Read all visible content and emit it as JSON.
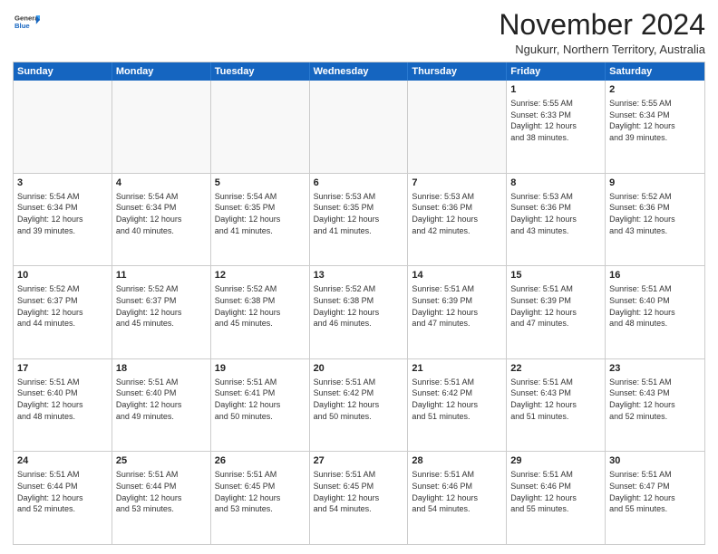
{
  "logo": {
    "line1": "General",
    "line2": "Blue"
  },
  "title": "November 2024",
  "subtitle": "Ngukurr, Northern Territory, Australia",
  "header_days": [
    "Sunday",
    "Monday",
    "Tuesday",
    "Wednesday",
    "Thursday",
    "Friday",
    "Saturday"
  ],
  "rows": [
    [
      {
        "day": "",
        "empty": true
      },
      {
        "day": "",
        "empty": true
      },
      {
        "day": "",
        "empty": true
      },
      {
        "day": "",
        "empty": true
      },
      {
        "day": "",
        "empty": true
      },
      {
        "day": "1",
        "info": "Sunrise: 5:55 AM\nSunset: 6:33 PM\nDaylight: 12 hours\nand 38 minutes."
      },
      {
        "day": "2",
        "info": "Sunrise: 5:55 AM\nSunset: 6:34 PM\nDaylight: 12 hours\nand 39 minutes."
      }
    ],
    [
      {
        "day": "3",
        "info": "Sunrise: 5:54 AM\nSunset: 6:34 PM\nDaylight: 12 hours\nand 39 minutes."
      },
      {
        "day": "4",
        "info": "Sunrise: 5:54 AM\nSunset: 6:34 PM\nDaylight: 12 hours\nand 40 minutes."
      },
      {
        "day": "5",
        "info": "Sunrise: 5:54 AM\nSunset: 6:35 PM\nDaylight: 12 hours\nand 41 minutes."
      },
      {
        "day": "6",
        "info": "Sunrise: 5:53 AM\nSunset: 6:35 PM\nDaylight: 12 hours\nand 41 minutes."
      },
      {
        "day": "7",
        "info": "Sunrise: 5:53 AM\nSunset: 6:36 PM\nDaylight: 12 hours\nand 42 minutes."
      },
      {
        "day": "8",
        "info": "Sunrise: 5:53 AM\nSunset: 6:36 PM\nDaylight: 12 hours\nand 43 minutes."
      },
      {
        "day": "9",
        "info": "Sunrise: 5:52 AM\nSunset: 6:36 PM\nDaylight: 12 hours\nand 43 minutes."
      }
    ],
    [
      {
        "day": "10",
        "info": "Sunrise: 5:52 AM\nSunset: 6:37 PM\nDaylight: 12 hours\nand 44 minutes."
      },
      {
        "day": "11",
        "info": "Sunrise: 5:52 AM\nSunset: 6:37 PM\nDaylight: 12 hours\nand 45 minutes."
      },
      {
        "day": "12",
        "info": "Sunrise: 5:52 AM\nSunset: 6:38 PM\nDaylight: 12 hours\nand 45 minutes."
      },
      {
        "day": "13",
        "info": "Sunrise: 5:52 AM\nSunset: 6:38 PM\nDaylight: 12 hours\nand 46 minutes."
      },
      {
        "day": "14",
        "info": "Sunrise: 5:51 AM\nSunset: 6:39 PM\nDaylight: 12 hours\nand 47 minutes."
      },
      {
        "day": "15",
        "info": "Sunrise: 5:51 AM\nSunset: 6:39 PM\nDaylight: 12 hours\nand 47 minutes."
      },
      {
        "day": "16",
        "info": "Sunrise: 5:51 AM\nSunset: 6:40 PM\nDaylight: 12 hours\nand 48 minutes."
      }
    ],
    [
      {
        "day": "17",
        "info": "Sunrise: 5:51 AM\nSunset: 6:40 PM\nDaylight: 12 hours\nand 48 minutes."
      },
      {
        "day": "18",
        "info": "Sunrise: 5:51 AM\nSunset: 6:40 PM\nDaylight: 12 hours\nand 49 minutes."
      },
      {
        "day": "19",
        "info": "Sunrise: 5:51 AM\nSunset: 6:41 PM\nDaylight: 12 hours\nand 50 minutes."
      },
      {
        "day": "20",
        "info": "Sunrise: 5:51 AM\nSunset: 6:42 PM\nDaylight: 12 hours\nand 50 minutes."
      },
      {
        "day": "21",
        "info": "Sunrise: 5:51 AM\nSunset: 6:42 PM\nDaylight: 12 hours\nand 51 minutes."
      },
      {
        "day": "22",
        "info": "Sunrise: 5:51 AM\nSunset: 6:43 PM\nDaylight: 12 hours\nand 51 minutes."
      },
      {
        "day": "23",
        "info": "Sunrise: 5:51 AM\nSunset: 6:43 PM\nDaylight: 12 hours\nand 52 minutes."
      }
    ],
    [
      {
        "day": "24",
        "info": "Sunrise: 5:51 AM\nSunset: 6:44 PM\nDaylight: 12 hours\nand 52 minutes."
      },
      {
        "day": "25",
        "info": "Sunrise: 5:51 AM\nSunset: 6:44 PM\nDaylight: 12 hours\nand 53 minutes."
      },
      {
        "day": "26",
        "info": "Sunrise: 5:51 AM\nSunset: 6:45 PM\nDaylight: 12 hours\nand 53 minutes."
      },
      {
        "day": "27",
        "info": "Sunrise: 5:51 AM\nSunset: 6:45 PM\nDaylight: 12 hours\nand 54 minutes."
      },
      {
        "day": "28",
        "info": "Sunrise: 5:51 AM\nSunset: 6:46 PM\nDaylight: 12 hours\nand 54 minutes."
      },
      {
        "day": "29",
        "info": "Sunrise: 5:51 AM\nSunset: 6:46 PM\nDaylight: 12 hours\nand 55 minutes."
      },
      {
        "day": "30",
        "info": "Sunrise: 5:51 AM\nSunset: 6:47 PM\nDaylight: 12 hours\nand 55 minutes."
      }
    ]
  ]
}
